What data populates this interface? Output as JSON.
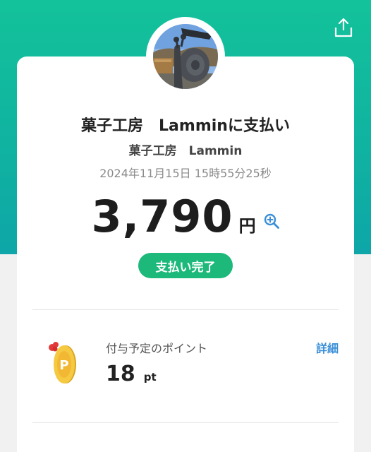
{
  "header": {
    "share_icon": "share-icon",
    "colors": {
      "gradient_top": "#13c29a",
      "gradient_bottom": "#0ea6a8"
    }
  },
  "payment": {
    "title": "菓子工房　Lamminに支払い",
    "merchant_name": "菓子工房　Lammin",
    "datetime": "2024年11月15日 15時55分25秒",
    "amount": "3,790",
    "currency": "円",
    "zoom_icon": "zoom-in-icon",
    "status": "支払い完了",
    "status_color": "#1db97a"
  },
  "points": {
    "label": "付与予定のポイント",
    "value": "18",
    "unit": "pt",
    "details_label": "詳細",
    "icon": "point-coin-icon"
  }
}
